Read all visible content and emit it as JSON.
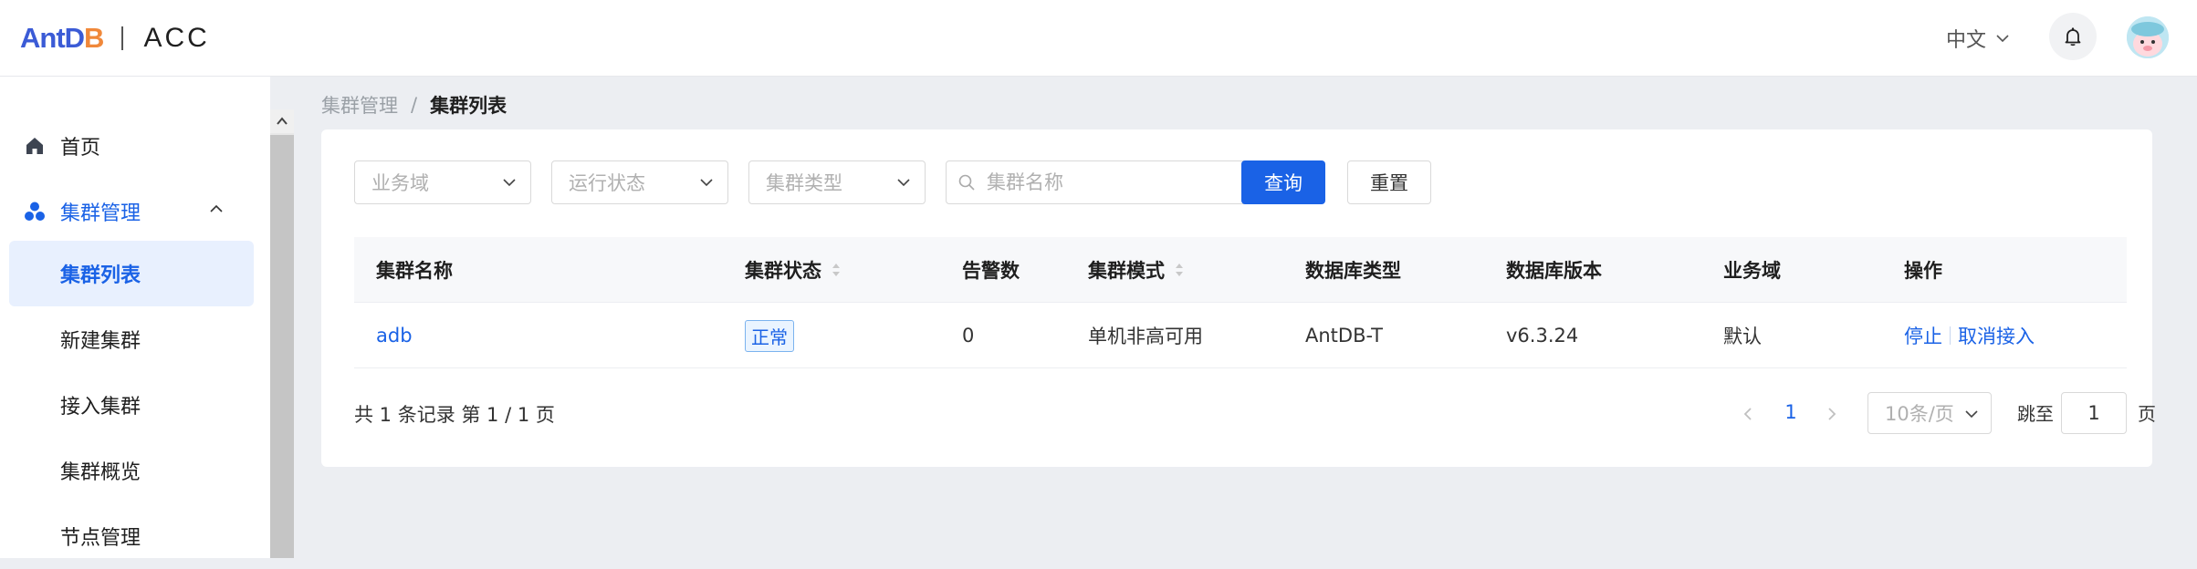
{
  "header": {
    "logo_main": "AntD",
    "logo_main_end": "B",
    "logo_sub": "ACC",
    "language": "中文",
    "icons": {
      "bell": "bell-icon",
      "avatar": "avatar",
      "lang_chevron": "chevron-down-icon"
    }
  },
  "sidebar": {
    "items": [
      {
        "label": "首页",
        "icon": "home-icon"
      },
      {
        "label": "集群管理",
        "icon": "cluster-icon",
        "expanded": true
      },
      {
        "label": "集群列表",
        "active": true
      },
      {
        "label": "新建集群"
      },
      {
        "label": "接入集群"
      },
      {
        "label": "集群概览"
      },
      {
        "label": "节点管理"
      }
    ]
  },
  "breadcrumb": {
    "parent": "集群管理",
    "separator": "/",
    "current": "集群列表"
  },
  "filters": {
    "business_domain": "业务域",
    "run_status": "运行状态",
    "cluster_type": "集群类型",
    "search_placeholder": "集群名称",
    "query_label": "查询",
    "reset_label": "重置"
  },
  "table": {
    "columns": [
      "集群名称",
      "集群状态",
      "告警数",
      "集群模式",
      "数据库类型",
      "数据库版本",
      "业务域",
      "操作"
    ],
    "rows": [
      {
        "name": "adb",
        "status": "正常",
        "alarms": "0",
        "mode": "单机非高可用",
        "db_type": "AntDB-T",
        "db_version": "v6.3.24",
        "domain": "默认",
        "actions": [
          "停止",
          "取消接入"
        ]
      }
    ]
  },
  "pagination": {
    "summary": "共 1 条记录 第 1 / 1 页",
    "current_page": "1",
    "page_size": "10条/页",
    "jump_label": "跳至",
    "jump_value": "1",
    "page_suffix": "页"
  },
  "colors": {
    "primary": "#1a62e6",
    "background": "#eceef2",
    "accent": "#f0883a"
  }
}
